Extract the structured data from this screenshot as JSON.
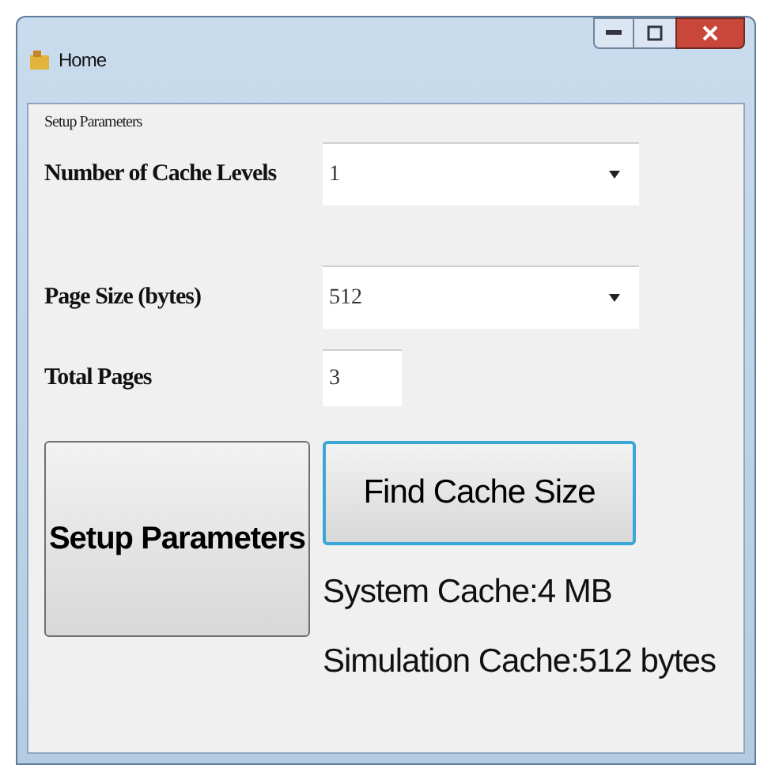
{
  "window": {
    "title": "Home"
  },
  "group": {
    "title": "Setup Parameters"
  },
  "fields": [
    {
      "label": "Number of Cache Levels",
      "kind": "dropdown",
      "value": "1"
    },
    {
      "label": "Page Size (bytes)",
      "kind": "dropdown",
      "value": "512"
    },
    {
      "label": "Total Pages",
      "kind": "text",
      "value": "3"
    }
  ],
  "buttons": [
    {
      "label": "Setup Parameters",
      "focused": false
    },
    {
      "label": "Find Cache Size",
      "focused": true
    }
  ],
  "results": [
    "System Cache:4 MB",
    "Simulation Cache:512 bytes"
  ]
}
